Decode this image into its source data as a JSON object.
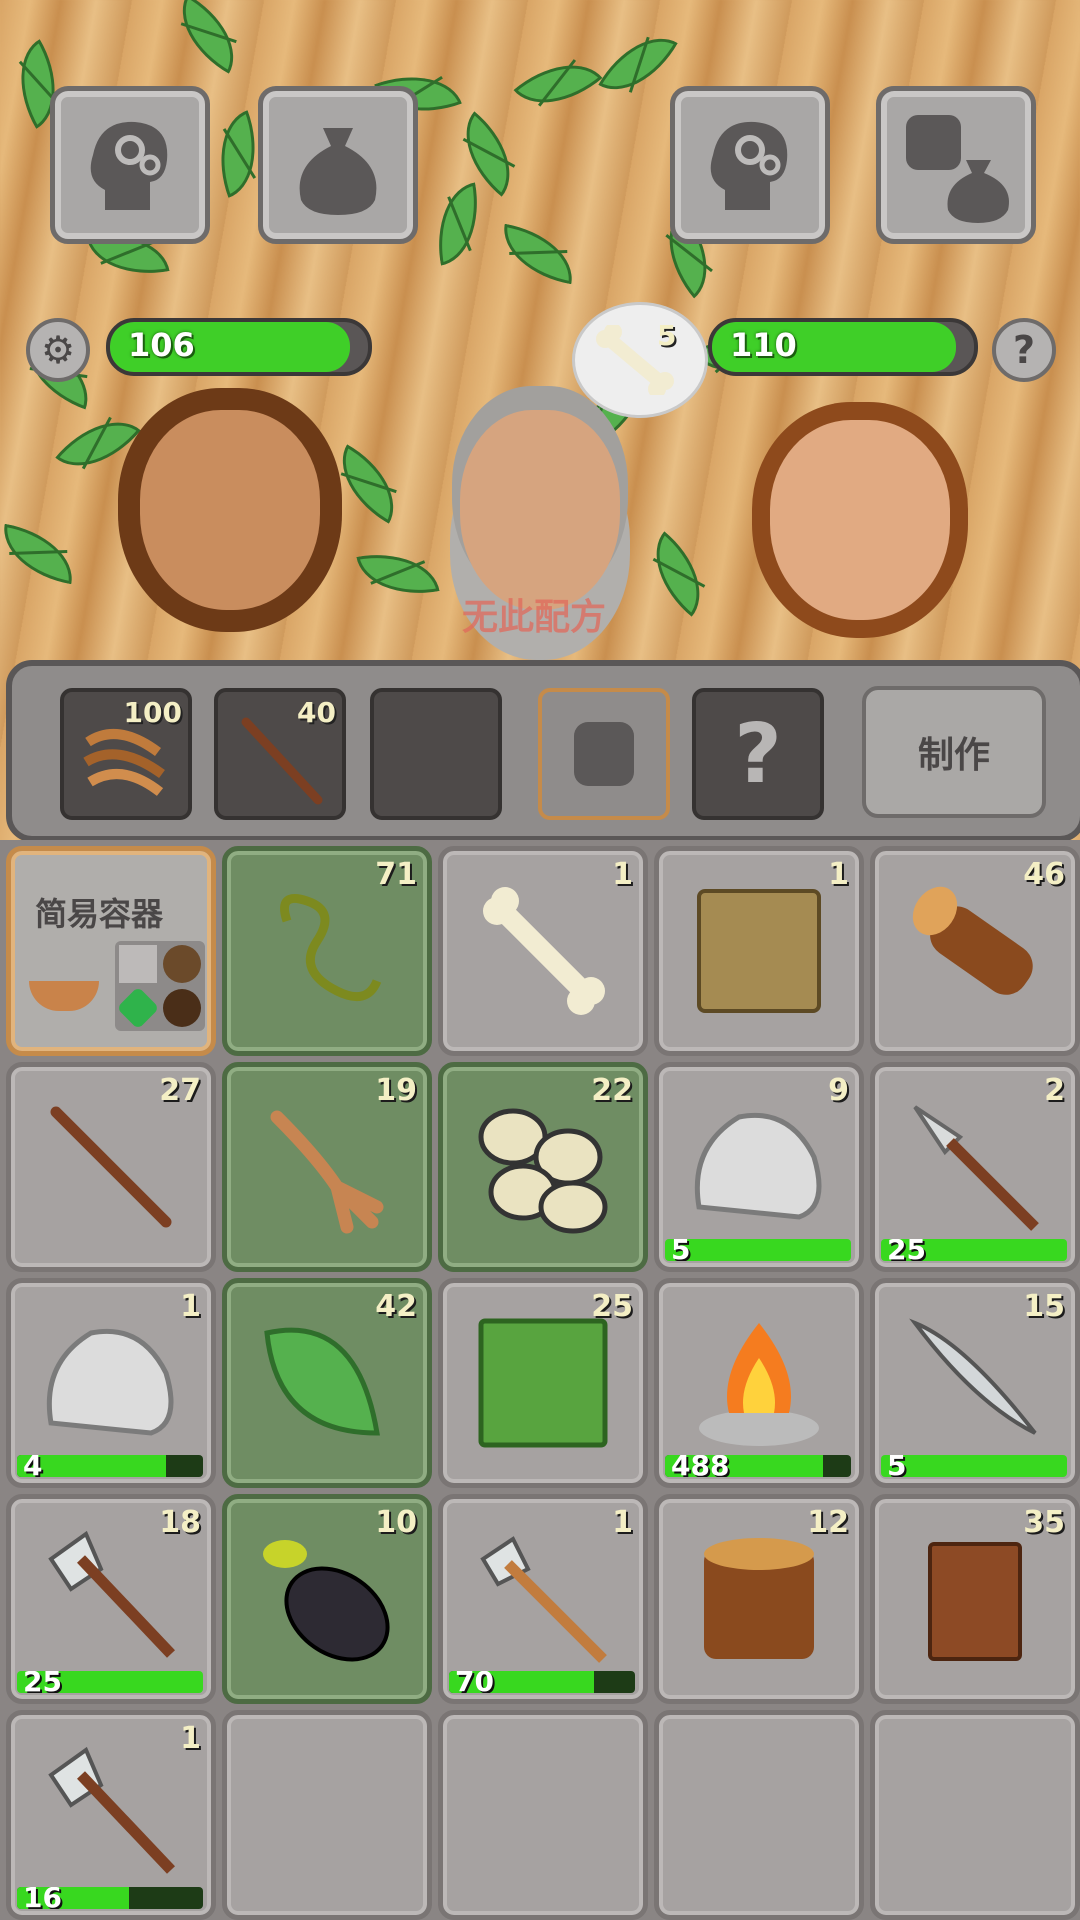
{
  "top_buttons": [
    {
      "name": "skills-button-left",
      "icon": "head-gears-icon"
    },
    {
      "name": "bag-button-left",
      "icon": "sack-icon"
    },
    {
      "name": "skills-button-right",
      "icon": "head-gears-icon"
    },
    {
      "name": "steal-button",
      "icon": "fist-sack-icon"
    }
  ],
  "stats": {
    "left_value": "106",
    "left_fill": 0.93,
    "right_value": "110",
    "right_fill": 0.93
  },
  "thought": {
    "count": "5",
    "icon": "bone-icon"
  },
  "no_recipe_text": "无此配方",
  "craft": {
    "slots": [
      {
        "count": "100",
        "icon": "bark-strips-icon"
      },
      {
        "count": "40",
        "icon": "stick-icon"
      },
      {
        "count": "",
        "icon": ""
      }
    ],
    "fist_icon": "fist-icon",
    "unknown_label": "?",
    "make_label": "制作"
  },
  "recipe": {
    "title": "简易容器"
  },
  "inventory": [
    {
      "count": "71",
      "icon": "vine-icon",
      "green": true
    },
    {
      "count": "1",
      "icon": "bone-icon",
      "green": false
    },
    {
      "count": "1",
      "icon": "fur-icon",
      "green": false
    },
    {
      "count": "46",
      "icon": "log-icon",
      "green": false
    },
    {
      "count": "27",
      "icon": "stick-icon",
      "green": false
    },
    {
      "count": "19",
      "icon": "root-icon",
      "green": true
    },
    {
      "count": "22",
      "icon": "eggplant-slices-icon",
      "green": true
    },
    {
      "count": "9",
      "icon": "stone-icon",
      "green": false,
      "dur": "5",
      "fill": 1.0
    },
    {
      "count": "2",
      "icon": "spear-icon",
      "green": false,
      "dur": "25",
      "fill": 1.0
    },
    {
      "count": "1",
      "icon": "stone-icon",
      "green": false,
      "dur": "4",
      "fill": 0.8
    },
    {
      "count": "42",
      "icon": "leaf-icon",
      "green": true
    },
    {
      "count": "25",
      "icon": "green-hide-icon",
      "green": false
    },
    {
      "count": "",
      "icon": "campfire-icon",
      "green": false,
      "dur": "488",
      "fill": 0.85
    },
    {
      "count": "15",
      "icon": "blade-icon",
      "green": false,
      "dur": "5",
      "fill": 1.0
    },
    {
      "count": "18",
      "icon": "axe-icon",
      "green": false,
      "dur": "25",
      "fill": 1.0
    },
    {
      "count": "10",
      "icon": "eggplant-icon",
      "green": true
    },
    {
      "count": "1",
      "icon": "stone-hammer-icon",
      "green": false,
      "dur": "70",
      "fill": 0.78
    },
    {
      "count": "12",
      "icon": "stump-icon",
      "green": false
    },
    {
      "count": "35",
      "icon": "plank-icon",
      "green": false
    },
    {
      "count": "1",
      "icon": "axe-icon",
      "green": false,
      "dur": "16",
      "fill": 0.6
    },
    {
      "count": "",
      "icon": "",
      "green": false
    },
    {
      "count": "",
      "icon": "",
      "green": false
    },
    {
      "count": "",
      "icon": "",
      "green": false
    },
    {
      "count": "",
      "icon": "",
      "green": false
    }
  ],
  "colors": {
    "bar": "#3fcf28",
    "stone": "#a9a7a6",
    "green_cell": "#6f8d63"
  }
}
